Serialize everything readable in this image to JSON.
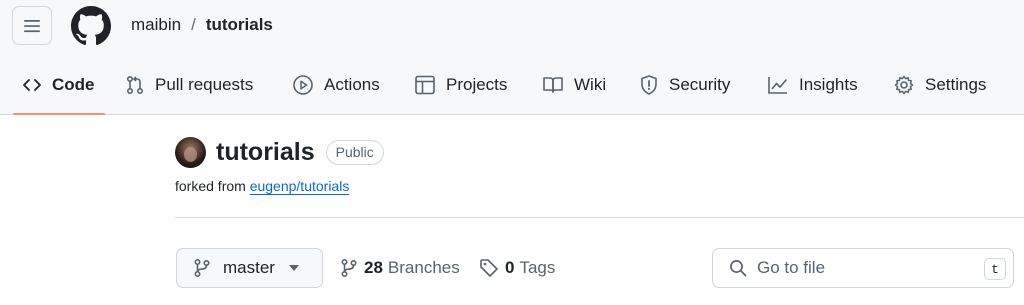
{
  "header": {
    "owner": "maibin",
    "separator": "/",
    "repo": "tutorials",
    "menu_icon": "hamburger-icon",
    "logo_icon": "github-logo-icon"
  },
  "nav": {
    "tabs": [
      {
        "label": "Code",
        "icon": "code-icon",
        "selected": true
      },
      {
        "label": "Pull requests",
        "icon": "pull-request-icon"
      },
      {
        "label": "Actions",
        "icon": "play-icon"
      },
      {
        "label": "Projects",
        "icon": "table-icon"
      },
      {
        "label": "Wiki",
        "icon": "book-icon"
      },
      {
        "label": "Security",
        "icon": "shield-icon"
      },
      {
        "label": "Insights",
        "icon": "graph-icon"
      },
      {
        "label": "Settings",
        "icon": "gear-icon"
      }
    ],
    "accent_color": "#fd8c73"
  },
  "repo": {
    "name": "tutorials",
    "visibility": "Public",
    "forked_prefix": "forked from",
    "forked_from": "eugenp/tutorials"
  },
  "toolbar": {
    "branch": "master",
    "branches_count": "28",
    "branches_label": "Branches",
    "tags_count": "0",
    "tags_label": "Tags",
    "search_placeholder": "Go to file",
    "search_shortcut": "t"
  },
  "colors": {
    "link": "#0969da",
    "border": "#d0d7de",
    "header_bg": "#f6f8fa"
  }
}
